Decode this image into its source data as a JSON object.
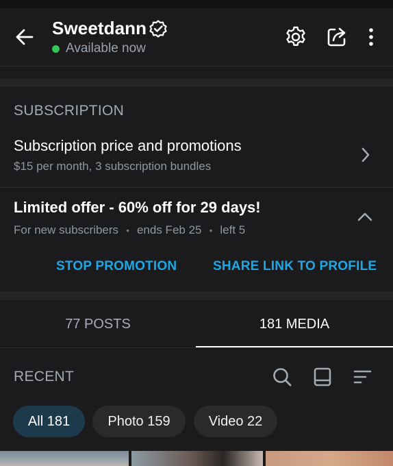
{
  "colors": {
    "accent": "#1ea7e6",
    "online": "#36c452",
    "background": "#1b1b1d"
  },
  "header": {
    "username": "Sweetdann",
    "status": "Available now",
    "icons": [
      "back-arrow-icon",
      "verified-badge-icon",
      "settings-gear-icon",
      "share-icon",
      "more-vertical-icon"
    ]
  },
  "subscription": {
    "section_title": "SUBSCRIPTION",
    "price_row": {
      "title": "Subscription price and promotions",
      "subtitle": "$15 per month, 3 subscription bundles"
    },
    "offer": {
      "title": "Limited offer - 60% off for 29 days!",
      "audience": "For new subscribers",
      "ends": "ends Feb 25",
      "left": "left 5",
      "separator": "•"
    },
    "actions": {
      "stop": "STOP PROMOTION",
      "share": "SHARE LINK TO PROFILE"
    }
  },
  "tabs": [
    {
      "label": "77 POSTS",
      "active": false
    },
    {
      "label": "181 MEDIA",
      "active": true
    }
  ],
  "media": {
    "section_title": "RECENT",
    "tools": [
      "search-icon",
      "grid-view-icon",
      "sort-icon"
    ],
    "filters": [
      {
        "label": "All 181",
        "active": true
      },
      {
        "label": "Photo 159",
        "active": false
      },
      {
        "label": "Video 22",
        "active": false
      }
    ]
  }
}
